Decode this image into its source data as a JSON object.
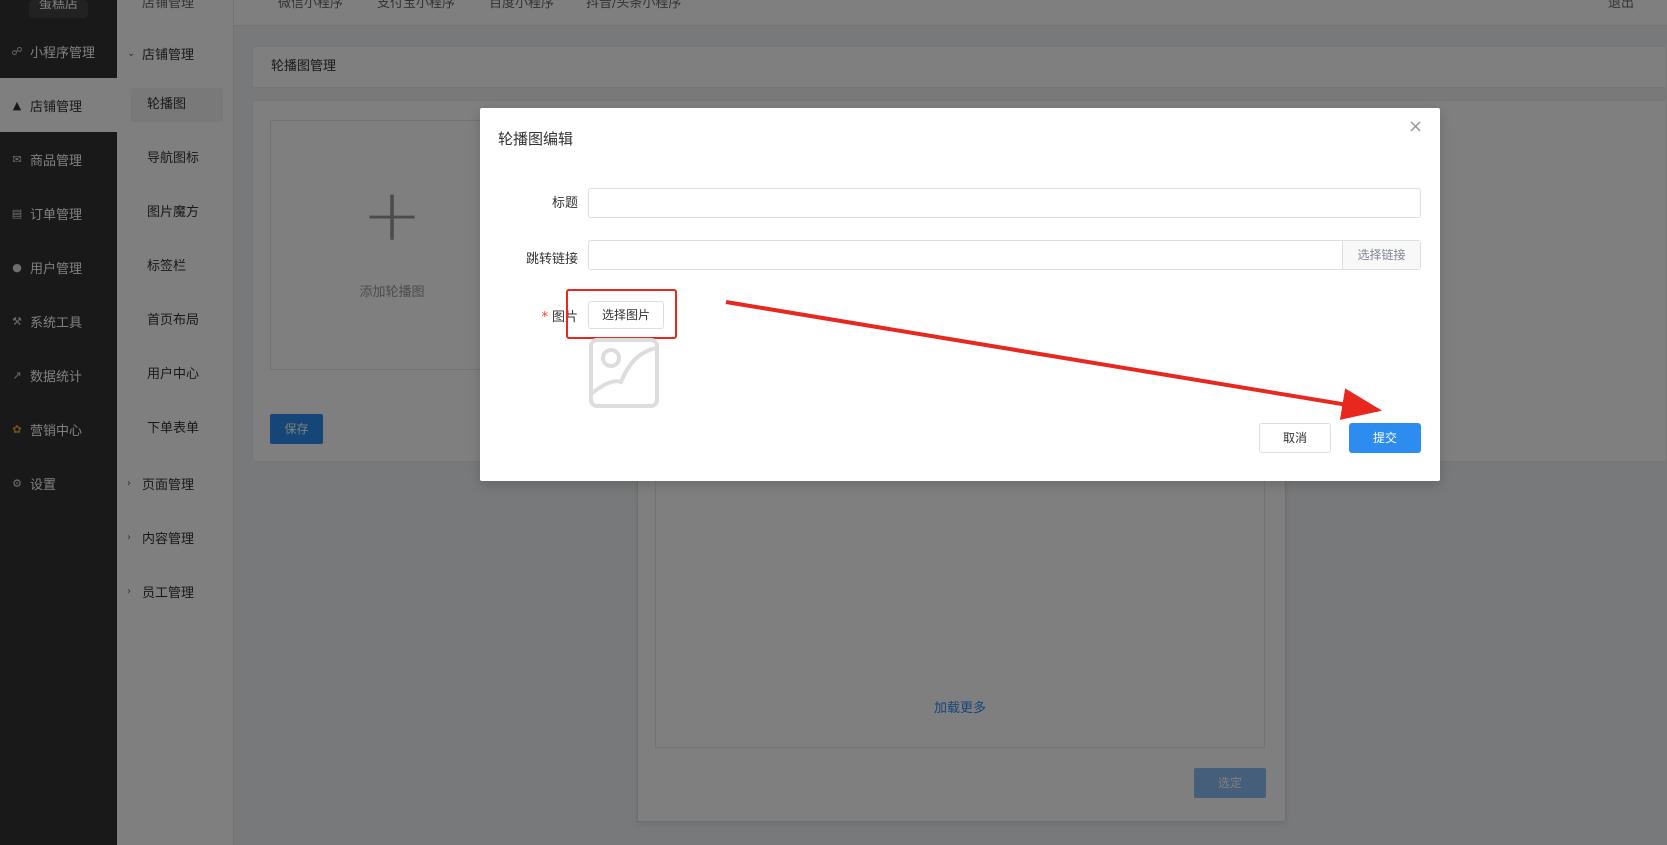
{
  "sidebar": {
    "logo": "蛋糕店",
    "items": [
      {
        "label": "小程序管理",
        "icon": "link-icon"
      },
      {
        "label": "店铺管理",
        "icon": "shop-icon",
        "active": true
      },
      {
        "label": "商品管理",
        "icon": "goods-icon"
      },
      {
        "label": "订单管理",
        "icon": "order-icon"
      },
      {
        "label": "用户管理",
        "icon": "user-icon"
      },
      {
        "label": "系统工具",
        "icon": "wrench-icon"
      },
      {
        "label": "数据统计",
        "icon": "chart-icon"
      },
      {
        "label": "营销中心",
        "icon": "marketing-icon"
      },
      {
        "label": "设置",
        "icon": "gear-icon"
      }
    ]
  },
  "subnav": {
    "top_cut": "店铺管理",
    "groups": [
      "店铺管理",
      "页面管理",
      "内容管理",
      "员工管理"
    ],
    "items": [
      "轮播图",
      "导航图标",
      "图片魔方",
      "标签栏",
      "首页布局",
      "用户中心",
      "下单表单"
    ]
  },
  "topbar": {
    "tabs": [
      "微信小程序",
      "支付宝小程序",
      "百度小程序",
      "抖音/头条小程序"
    ],
    "right": "退出"
  },
  "content": {
    "panel_title": "轮播图管理",
    "add_label": "添加轮播图",
    "save_label": "保存",
    "picker_more": "加载更多",
    "picker_ok": "选定"
  },
  "modal": {
    "title": "轮播图编辑",
    "title_label": "标题",
    "title_value": "",
    "link_label": "跳转链接",
    "link_value": "",
    "link_append": "选择链接",
    "image_label": "图片",
    "image_button": "选择图片",
    "cancel": "取消",
    "submit": "提交"
  },
  "colors": {
    "primary": "#2d8cf0",
    "sidebar_bg": "#333333",
    "annotation_red": "#e8271f"
  }
}
